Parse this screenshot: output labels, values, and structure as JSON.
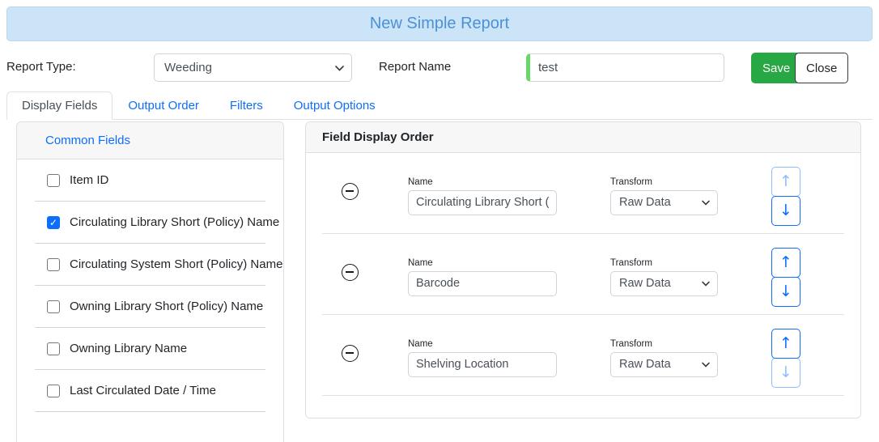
{
  "header": {
    "title": "New Simple Report"
  },
  "toolbar": {
    "report_type_label": "Report Type:",
    "report_type_value": "Weeding",
    "report_name_label": "Report Name",
    "report_name_value": "test",
    "save_label": "Save",
    "close_label": "Close"
  },
  "tabs": [
    {
      "label": "Display Fields",
      "active": true
    },
    {
      "label": "Output Order",
      "active": false
    },
    {
      "label": "Filters",
      "active": false
    },
    {
      "label": "Output Options",
      "active": false
    }
  ],
  "fields_panel": {
    "group_label": "Common Fields",
    "items": [
      {
        "label": "Item ID",
        "checked": false
      },
      {
        "label": "Circulating Library Short (Policy) Name",
        "checked": true
      },
      {
        "label": "Circulating System Short (Policy) Name",
        "checked": false
      },
      {
        "label": "Owning Library Short (Policy) Name",
        "checked": false
      },
      {
        "label": "Owning Library Name",
        "checked": false
      },
      {
        "label": "Last Circulated Date / Time",
        "checked": false
      }
    ]
  },
  "display_order_panel": {
    "title": "Field Display Order",
    "name_label": "Name",
    "transform_label": "Transform",
    "rows": [
      {
        "name": "Circulating Library Short (",
        "transform": "Raw Data",
        "up_disabled": true,
        "down_disabled": false
      },
      {
        "name": "Barcode",
        "transform": "Raw Data",
        "up_disabled": false,
        "down_disabled": false
      },
      {
        "name": "Shelving Location",
        "transform": "Raw Data",
        "up_disabled": false,
        "down_disabled": true
      }
    ]
  },
  "icons": {
    "chevron_down": "chevron-down",
    "minus_circle": "minus-circle",
    "arrow_up": "↑",
    "arrow_down": "↓",
    "check": "✓"
  },
  "colors": {
    "banner_bg": "#cce4f8",
    "banner_text": "#4a92d5",
    "accent_blue": "#0d6efd",
    "save_green": "#28a745",
    "valid_green": "#68d968"
  }
}
